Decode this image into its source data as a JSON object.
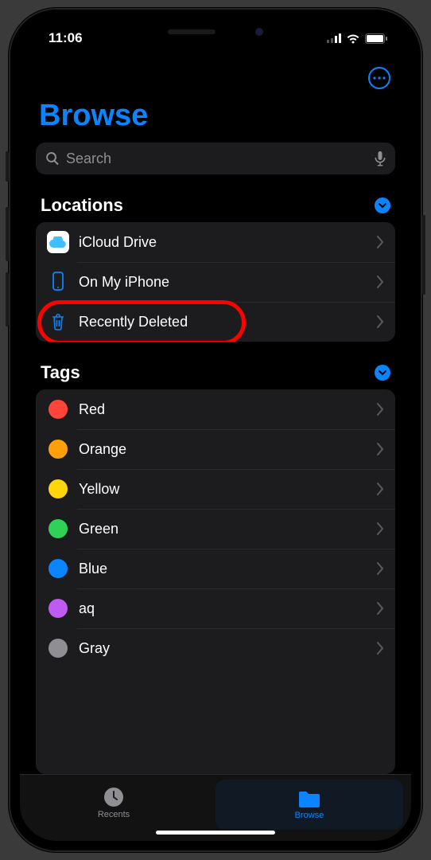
{
  "status": {
    "time": "11:06"
  },
  "page_title": "Browse",
  "search": {
    "placeholder": "Search"
  },
  "sections": {
    "locations": {
      "title": "Locations",
      "items": [
        {
          "label": "iCloud Drive"
        },
        {
          "label": "On My iPhone"
        },
        {
          "label": "Recently Deleted"
        }
      ]
    },
    "tags": {
      "title": "Tags",
      "items": [
        {
          "label": "Red",
          "color": "#ff453a"
        },
        {
          "label": "Orange",
          "color": "#ff9f0a"
        },
        {
          "label": "Yellow",
          "color": "#ffd60a"
        },
        {
          "label": "Green",
          "color": "#30d158"
        },
        {
          "label": "Blue",
          "color": "#0a84ff"
        },
        {
          "label": "aq",
          "color": "#bf5af2"
        },
        {
          "label": "Gray",
          "color": "#8e8e93"
        }
      ]
    }
  },
  "tabs": {
    "recents": "Recents",
    "browse": "Browse"
  }
}
